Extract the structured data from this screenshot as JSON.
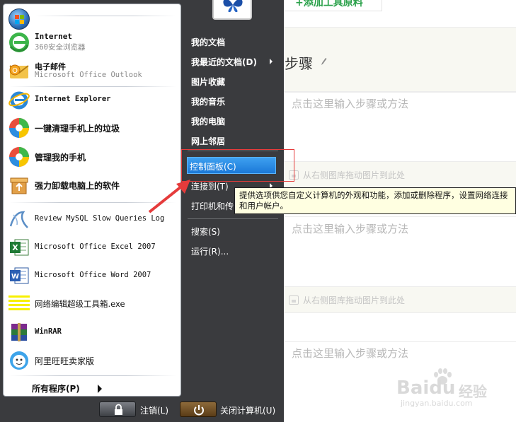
{
  "background": {
    "top_button": "+添加工具原料",
    "steps_title": "步骤",
    "placeholder_1": "点击这里输入步骤或方法",
    "image_slot_1": "从右侧图库拖动图片到此处",
    "placeholder_2": "点击这里输入步骤或方法",
    "image_slot_2": "从右侧图库拖动图片到此处",
    "placeholder_3": "点击这里输入步骤或方法",
    "watermark_brand": "Baidu",
    "watermark_jy": "经验",
    "watermark_url": "jingyan.baidu.com"
  },
  "start_menu": {
    "pinned": [
      {
        "title": "Internet",
        "subtitle": "360安全浏览器",
        "icon": "360-browser-icon"
      },
      {
        "title": "电子邮件",
        "subtitle": "Microsoft Office Outlook",
        "icon": "outlook-icon"
      }
    ],
    "recent": [
      {
        "label": "Internet Explorer",
        "icon": "ie-icon"
      },
      {
        "label": "一键清理手机上的垃圾",
        "icon": "phone-clean-icon"
      },
      {
        "label": "管理我的手机",
        "icon": "phone-manager-icon"
      },
      {
        "label": "强力卸载电脑上的软件",
        "icon": "uninstall-icon"
      },
      {
        "label": "Review MySQL Slow Queries Log",
        "icon": "mysql-icon"
      },
      {
        "label": "Microsoft Office Excel 2007",
        "icon": "excel-icon"
      },
      {
        "label": "Microsoft Office Word 2007",
        "icon": "word-icon"
      },
      {
        "label": "网络编辑超级工具箱.exe",
        "icon": "toolbox-exe-icon"
      },
      {
        "label": "WinRAR",
        "icon": "winrar-icon"
      },
      {
        "label": "阿里旺旺卖家版",
        "icon": "aliwangwang-icon"
      }
    ],
    "all_programs": "所有程序(P)",
    "right": {
      "my_documents": "我的文档",
      "recent_documents": "我最近的文档(D)",
      "my_pictures": "图片收藏",
      "my_music": "我的音乐",
      "my_computer": "我的电脑",
      "network_places": "网上邻居",
      "control_panel": "控制面板(C)",
      "connect_to": "连接到(T)",
      "printers": "打印机和传",
      "search": "搜索(S)",
      "run": "运行(R)..."
    },
    "tooltip": "提供选项供您自定义计算机的外观和功能，添加或删除程序，设置网络连接和用户帐户。",
    "logoff": "注销(L)",
    "shutdown": "关闭计算机(U)"
  },
  "colors": {
    "menu_bg": "#3a3b3e",
    "highlight": "#1b79d8",
    "annotation_red": "#e53b3b",
    "tooltip_bg": "#ffffe1"
  }
}
